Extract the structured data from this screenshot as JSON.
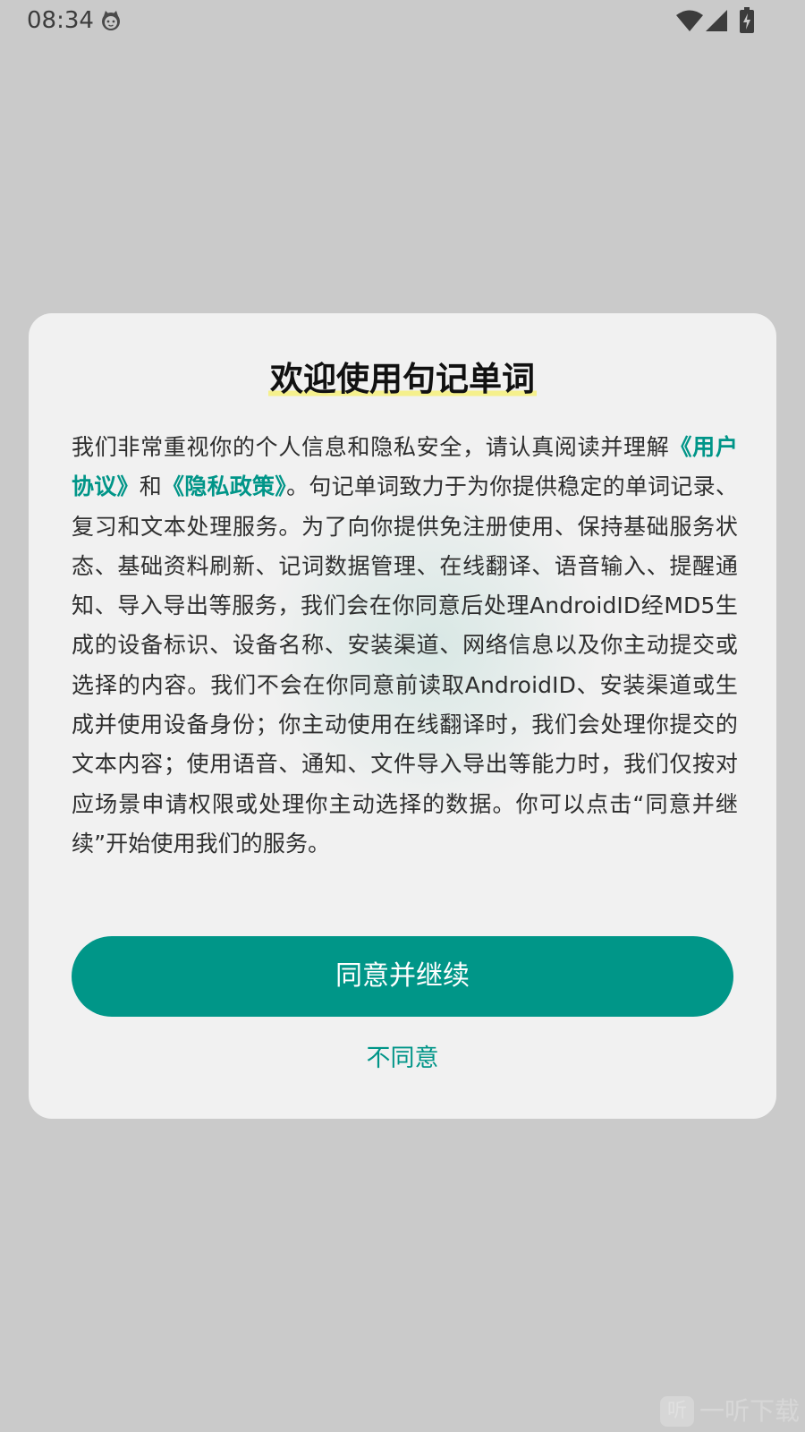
{
  "status_bar": {
    "time": "08:34",
    "icons": {
      "app": "cat-face-icon",
      "wifi": "wifi-icon",
      "signal": "cellular-signal-icon",
      "battery": "battery-charging-icon"
    }
  },
  "dialog": {
    "title": "欢迎使用句记单词",
    "body": {
      "intro": "我们非常重视你的个人信息和隐私安全，请认真阅读并理解",
      "user_agreement_link": "《用户协议》",
      "and": "和",
      "privacy_policy_link": "《隐私政策》",
      "rest": "。句记单词致力于为你提供稳定的单词记录、复习和文本处理服务。为了向你提供免注册使用、保持基础服务状态、基础资料刷新、记词数据管理、在线翻译、语音输入、提醒通知、导入导出等服务，我们会在你同意后处理AndroidID经MD5生成的设备标识、设备名称、安装渠道、网络信息以及你主动提交或选择的内容。我们不会在你同意前读取AndroidID、安装渠道或生成并使用设备身份；你主动使用在线翻译时，我们会处理你提交的文本内容；使用语音、通知、文件导入导出等能力时，我们仅按对应场景申请权限或处理你主动选择的数据。你可以点击“同意并继续”开始使用我们的服务。"
    },
    "agree_button": "同意并继续",
    "disagree_button": "不同意"
  },
  "watermark": {
    "logo_glyph": "听",
    "text": "一听下载"
  },
  "colors": {
    "accent": "#009688",
    "background": "#cacaca",
    "dialog": "#f1f1f1",
    "title_highlight": "#f5f08c"
  }
}
